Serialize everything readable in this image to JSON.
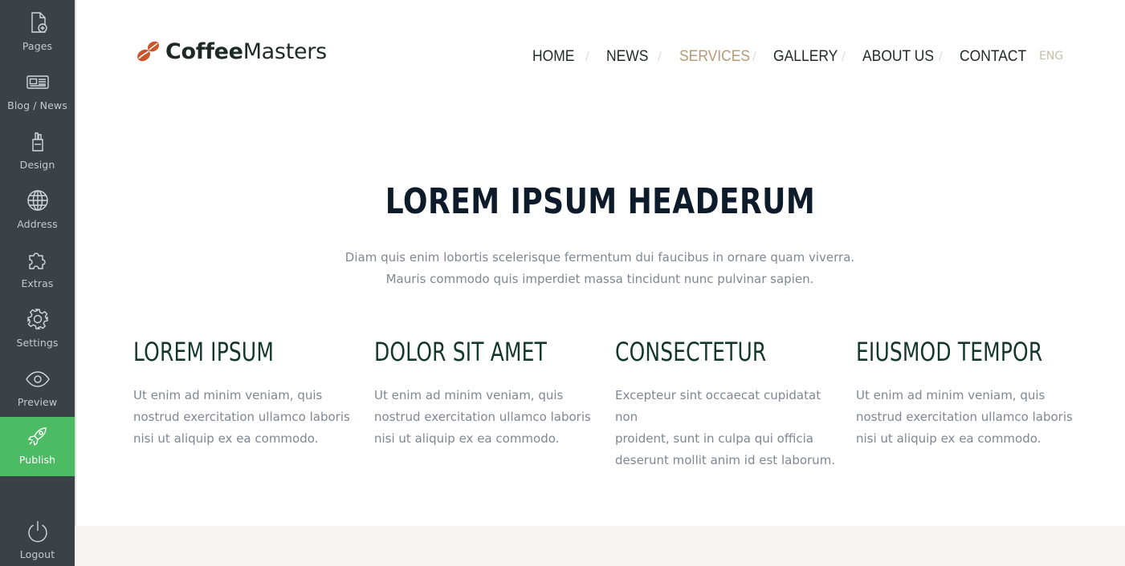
{
  "sidebar": {
    "items": [
      {
        "label": "Pages",
        "icon": "page-add-icon"
      },
      {
        "label": "Blog / News",
        "icon": "newspaper-icon"
      },
      {
        "label": "Design",
        "icon": "brush-icon"
      },
      {
        "label": "Address",
        "icon": "globe-icon"
      },
      {
        "label": "Extras",
        "icon": "puzzle-icon"
      },
      {
        "label": "Settings",
        "icon": "gear-icon"
      },
      {
        "label": "Preview",
        "icon": "eye-icon"
      },
      {
        "label": "Publish",
        "icon": "rocket-icon"
      }
    ],
    "logout": {
      "label": "Logout",
      "icon": "power-icon"
    },
    "colors": {
      "background": "#3a4248",
      "publish": "#4cbb63"
    }
  },
  "site": {
    "logo": {
      "bold": "Coffee",
      "light": "Masters"
    },
    "nav": [
      "HOME",
      "NEWS",
      "SERVICES",
      "GALLERY",
      "ABOUT US",
      "CONTACT"
    ],
    "nav_active": "SERVICES",
    "nav_separator": "/",
    "language": "ENG",
    "colors": {
      "accent": "#b79a76",
      "logo_bean": "#c8552b",
      "heading": "#14372b"
    }
  },
  "hero": {
    "title": "LOREM IPSUM HEADERUM",
    "subtitle_line1": "Diam quis enim lobortis scelerisque fermentum dui faucibus in ornare quam viverra.",
    "subtitle_line2": "Mauris commodo quis imperdiet massa tincidunt nunc pulvinar sapien."
  },
  "features": [
    {
      "title": "LOREM IPSUM",
      "lines": [
        "Ut enim ad minim veniam, quis",
        "nostrud exercitation ullamco laboris",
        "nisi ut aliquip ex ea commodo."
      ]
    },
    {
      "title": "DOLOR SIT AMET",
      "lines": [
        "Ut enim ad minim veniam, quis",
        "nostrud exercitation ullamco laboris",
        "nisi ut aliquip ex ea commodo."
      ]
    },
    {
      "title": "CONSECTETUR",
      "lines": [
        "Excepteur sint occaecat cupidatat non",
        "proident, sunt in culpa qui officia",
        "deserunt mollit anim id est laborum."
      ]
    },
    {
      "title": "EIUSMOD TEMPOR",
      "lines": [
        "Ut enim ad minim veniam, quis",
        "nostrud exercitation ullamco laboris",
        "nisi ut aliquip ex ea commodo."
      ]
    }
  ]
}
